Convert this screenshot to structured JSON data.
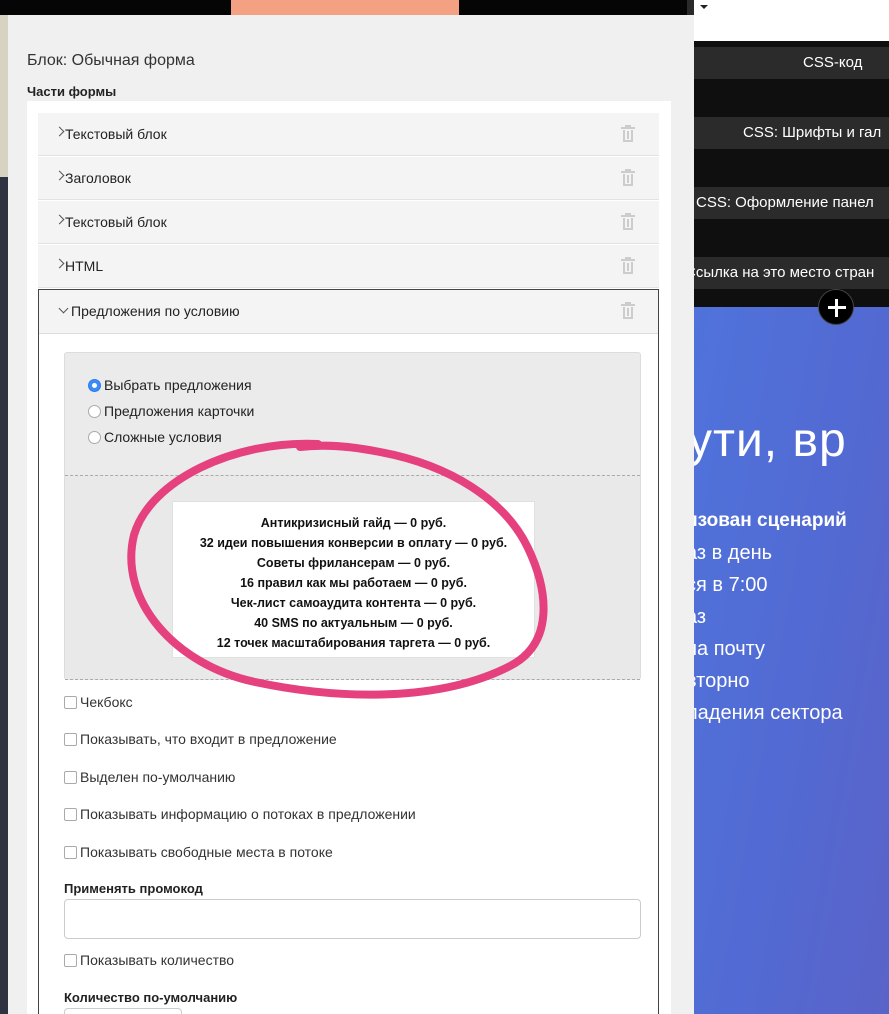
{
  "editor": {
    "block_title": "Блок: Обычная форма",
    "parts_title": "Части формы",
    "parts": [
      {
        "label": "Текстовый блок"
      },
      {
        "label": "Заголовок"
      },
      {
        "label": "Текстовый блок"
      },
      {
        "label": "HTML"
      }
    ],
    "expanded_part": {
      "label": "Предложения по условию",
      "radios": [
        {
          "label": "Выбрать предложения",
          "checked": true
        },
        {
          "label": "Предложения карточки",
          "checked": false
        },
        {
          "label": "Сложные условия",
          "checked": false
        }
      ],
      "offers": [
        "Антикризисный гайд — 0 руб.",
        "32 идеи повышения конверсии в оплату — 0 руб.",
        "Советы фрилансерам — 0 руб.",
        "16 правил как мы работаем — 0 руб.",
        "Чек-лист самоаудита контента — 0 руб.",
        "40 SMS по актуальным — 0 руб.",
        "12 точек масштабирования таргета — 0 руб."
      ],
      "checkboxes": [
        {
          "label": "Чекбокс",
          "checked": false
        },
        {
          "label": "Показывать, что входит в предложение",
          "checked": false
        },
        {
          "label": "Выделен по-умолчанию",
          "checked": false
        },
        {
          "label": "Показывать информацию о потоках в предложении",
          "checked": false
        },
        {
          "label": "Показывать свободные места в потоке",
          "checked": false
        }
      ],
      "promo_label": "Применять промокод",
      "promo_value": "",
      "show_quantity_label": "Показывать количество",
      "default_quantity_label": "Количество по-умолчанию"
    }
  },
  "preview": {
    "buttons": [
      "CSS-код",
      "CSS: Шрифты и гал",
      "CSS: Оформление панел",
      "Ссылка на это место стран"
    ],
    "hero_title": "ути, вр",
    "hero_lines": [
      "изован сценарий",
      "аз в день",
      "ся в 7:00",
      "аз",
      " на почту",
      "вторно",
      "ладения сектора"
    ]
  },
  "colors": {
    "accent_tab": "#f3a182",
    "annotation_circle": "#e5417e",
    "radio_selected": "#3d8bf7",
    "hero_gradient_start": "#4f73db",
    "hero_gradient_end": "#5a63c8"
  },
  "icons": {
    "row_delete": "trash-icon",
    "row_toggle": "chevron-right-icon",
    "expanded_toggle": "chevron-down-icon",
    "add_block": "plus-icon",
    "dropdown": "caret-down-icon"
  }
}
